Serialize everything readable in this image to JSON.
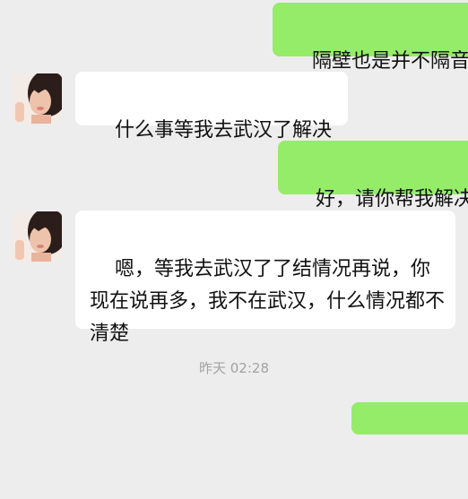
{
  "messages": [
    {
      "id": "m1",
      "direction": "outgoing",
      "text": "隔壁也是并不隔音"
    },
    {
      "id": "m2",
      "direction": "incoming",
      "avatar": "contact-avatar",
      "text": "什么事等我去武汉了解决"
    },
    {
      "id": "m3",
      "direction": "outgoing",
      "text": "好，请你帮我解决"
    },
    {
      "id": "m4",
      "direction": "incoming",
      "avatar": "contact-avatar",
      "text": "嗯，等我去武汉了了结情况再说，你现在说再多，我不在武汉，什么情况都不清楚"
    },
    {
      "id": "m5",
      "direction": "outgoing",
      "text": ""
    }
  ],
  "timestamp": "昨天 02:28",
  "colors": {
    "background": "#ededed",
    "outgoing_bubble": "#95ec69",
    "incoming_bubble": "#ffffff",
    "timestamp_text": "#a2a2a2"
  }
}
